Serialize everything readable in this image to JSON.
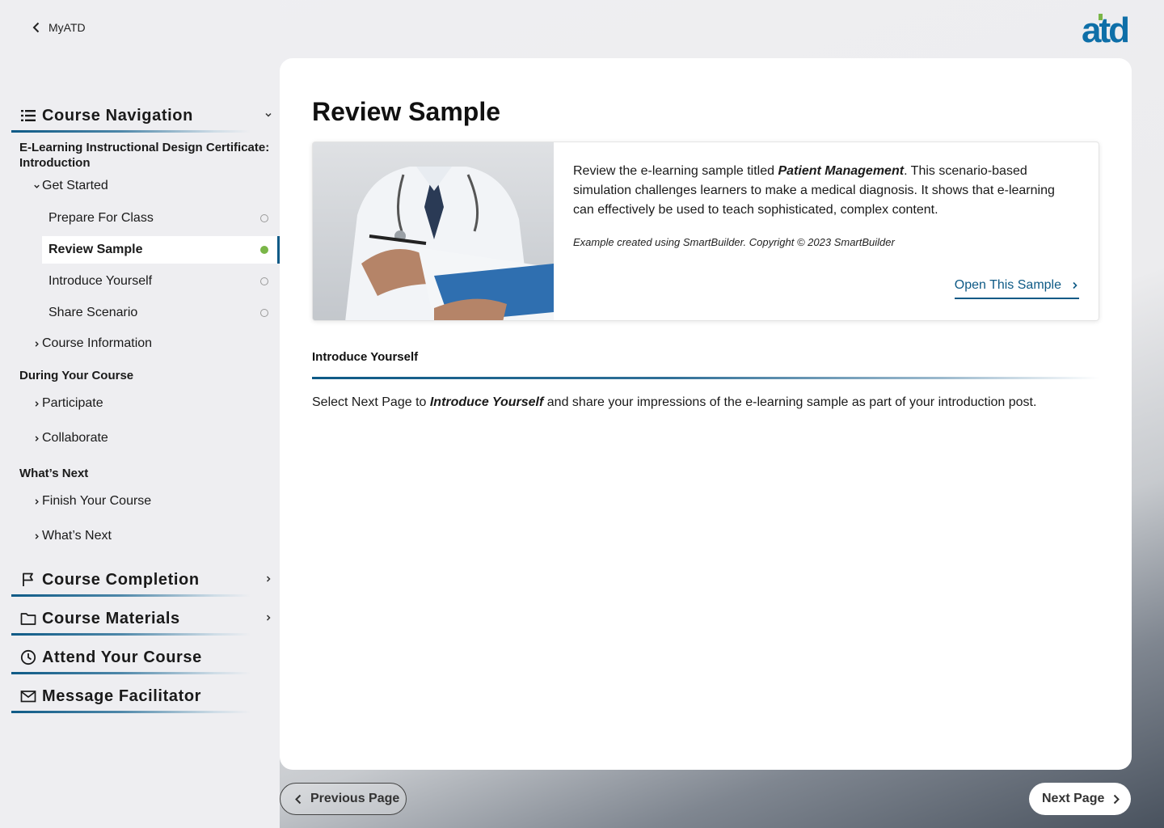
{
  "topbar": {
    "back_label": "MyATD",
    "logo_text": "atd"
  },
  "colors": {
    "brand": "#0e5a86",
    "logo_blue": "#0e6fa8",
    "logo_green": "#7ab648",
    "active_dot": "#7ab648"
  },
  "sidebar": {
    "course_nav_title": "Course Navigation",
    "course_title": "E-Learning Instructional Design Certificate: Introduction",
    "get_started": "Get Started",
    "items": [
      {
        "label": "Prepare For Class"
      },
      {
        "label": "Review Sample"
      },
      {
        "label": "Introduce Yourself"
      },
      {
        "label": "Share Scenario"
      }
    ],
    "course_information": "Course Information",
    "during_heading": "During Your Course",
    "participate": "Participate",
    "collaborate": "Collaborate",
    "whats_next_heading": "What’s Next",
    "finish_course": "Finish Your Course",
    "whats_next": "What’s Next",
    "sections": [
      {
        "label": "Course Completion",
        "icon": "flag-icon"
      },
      {
        "label": "Course Materials",
        "icon": "folder-icon"
      },
      {
        "label": "Attend Your Course",
        "icon": "clock-icon"
      },
      {
        "label": "Message Facilitator",
        "icon": "mail-icon"
      }
    ]
  },
  "main": {
    "title": "Review Sample",
    "desc_pre": "Review the e-learning sample titled ",
    "desc_em": "Patient Management",
    "desc_post": ". This scenario-based simulation challenges learners to make a medical diagnosis. It shows that e-learning can effectively be used to teach sophisticated, complex content.",
    "credit": "Example created using SmartBuilder. Copyright © 2023 SmartBuilder",
    "open_link": "Open This Sample",
    "section_title": "Introduce Yourself",
    "section_pre": "Select Next Page to ",
    "section_em": "Introduce Yourself",
    "section_post": " and share your impressions of the e-learning sample as part of your introduction post."
  },
  "footer": {
    "prev": "Previous Page",
    "next": "Next Page"
  }
}
